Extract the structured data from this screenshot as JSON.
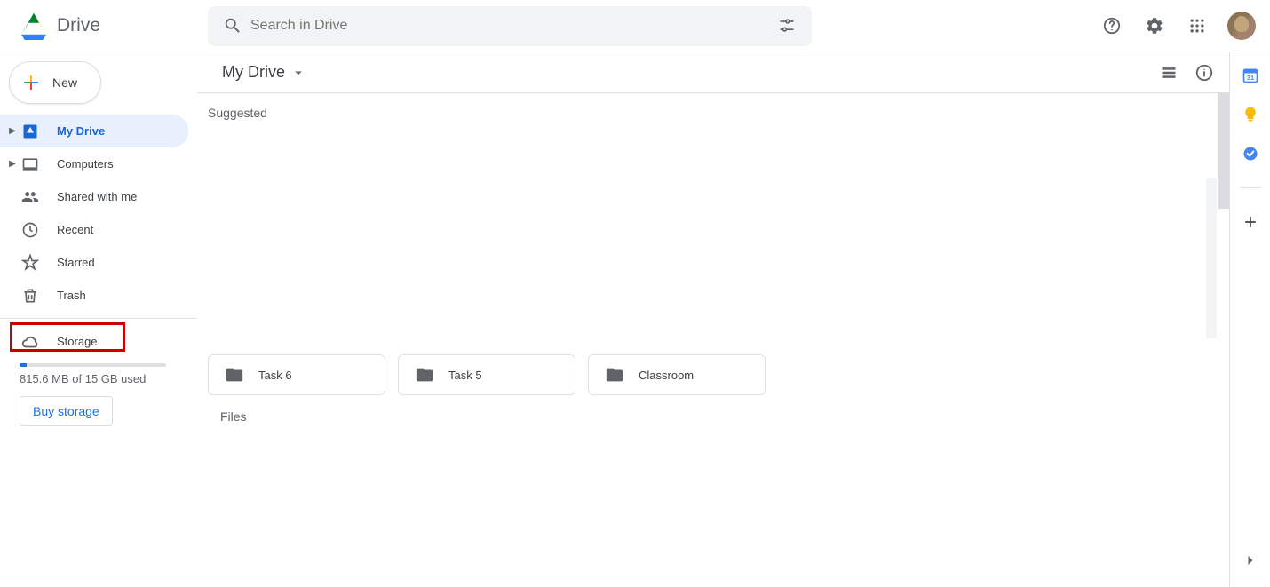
{
  "app_title": "Drive",
  "search": {
    "placeholder": "Search in Drive"
  },
  "sidebar": {
    "new_label": "New",
    "items": [
      {
        "label": "My Drive"
      },
      {
        "label": "Computers"
      },
      {
        "label": "Shared with me"
      },
      {
        "label": "Recent"
      },
      {
        "label": "Starred"
      },
      {
        "label": "Trash"
      }
    ],
    "storage": {
      "label": "Storage",
      "used_text": "815.6 MB of 15 GB used",
      "buy_label": "Buy storage"
    }
  },
  "main": {
    "location": "My Drive",
    "sections": {
      "suggested_label": "Suggested",
      "files_label": "Files"
    },
    "folders": [
      {
        "name": "Task 6"
      },
      {
        "name": "Task 5"
      },
      {
        "name": "Classroom"
      }
    ]
  }
}
